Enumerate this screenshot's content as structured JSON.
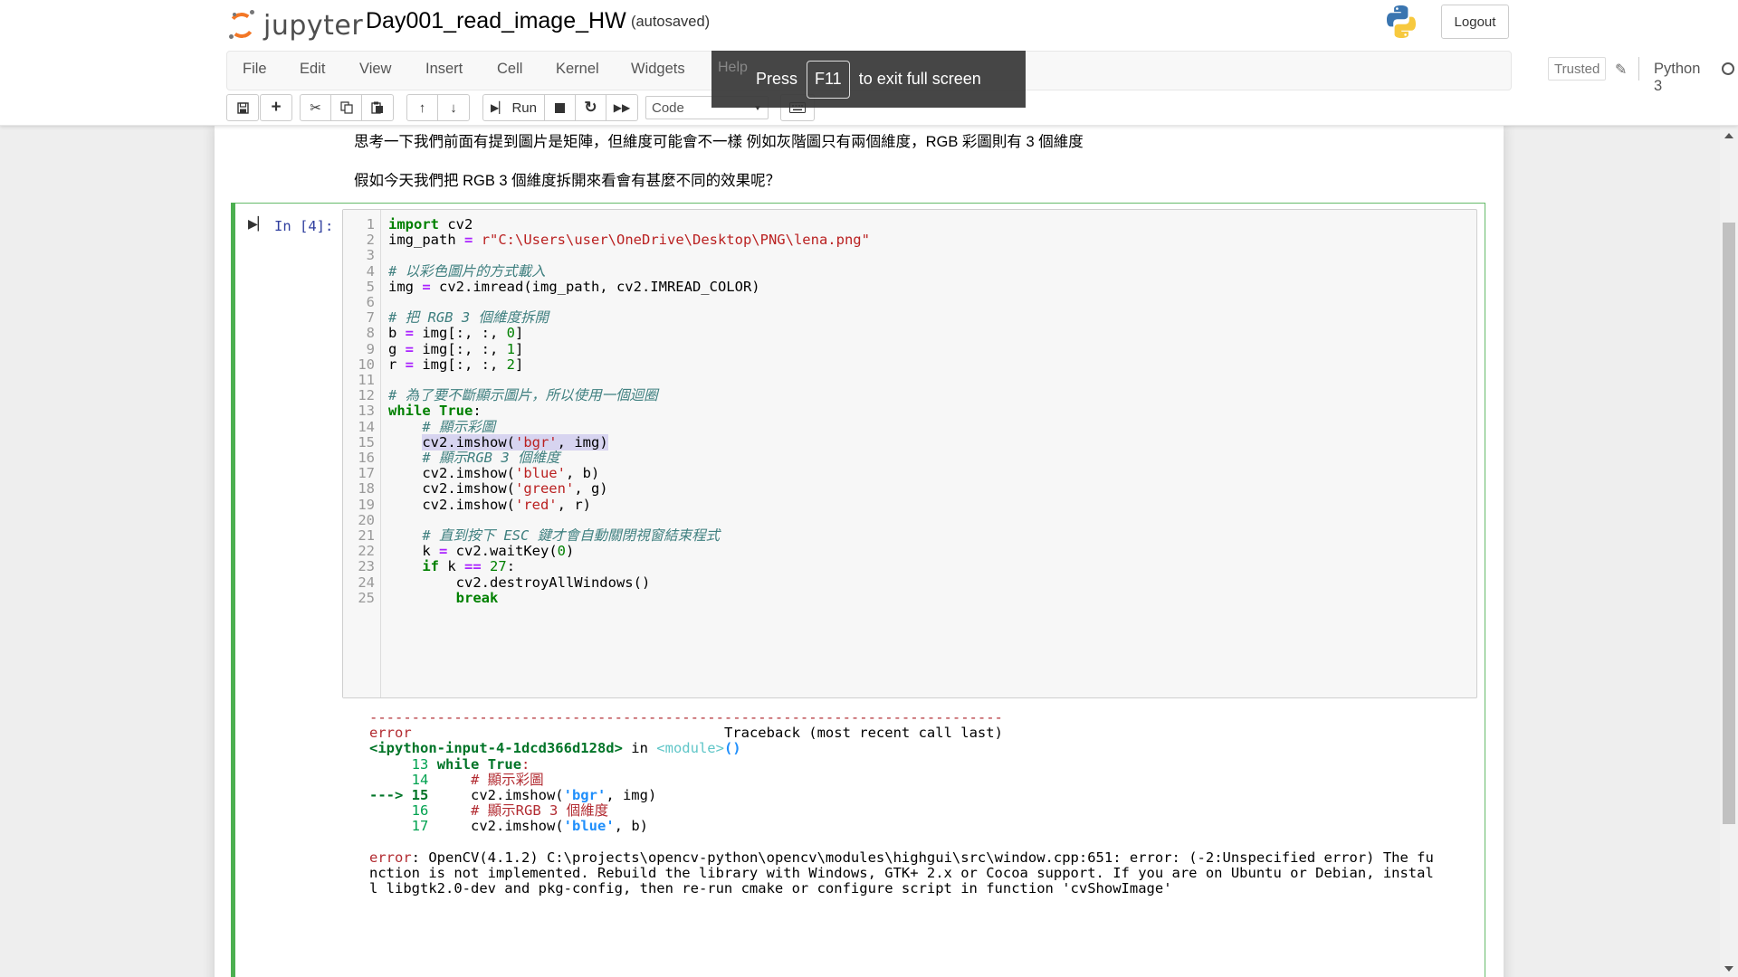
{
  "header": {
    "logo_text": "jupyter",
    "notebook_name": "Day001_read_image_HW",
    "save_status": "(autosaved)",
    "logout_label": "Logout"
  },
  "menubar": {
    "items": [
      "File",
      "Edit",
      "View",
      "Insert",
      "Cell",
      "Kernel",
      "Widgets",
      "Help"
    ],
    "trusted_label": "Trusted",
    "kernel_name": "Python 3"
  },
  "toolbar": {
    "run_label": "Run",
    "cell_type": "Code"
  },
  "fullscreen_toast": {
    "prefix": "Press",
    "key": "F11",
    "suffix": "to exit full screen"
  },
  "markdown": {
    "line1": "思考一下我們前面有提到圖片是矩陣，但維度可能會不一樣 例如灰階圖只有兩個維度，RGB 彩圖則有 3 個維度",
    "line2": "假如今天我們把 RGB 3 個維度拆開來看會有甚麼不同的效果呢？"
  },
  "cell": {
    "prompt": "In [4]:",
    "code_lines": [
      "import cv2",
      "img_path = r\"C:\\Users\\user\\OneDrive\\Desktop\\PNG\\lena.png\"",
      "",
      "# 以彩色圖片的方式載入",
      "img = cv2.imread(img_path, cv2.IMREAD_COLOR)",
      "",
      "# 把 RGB 3 個維度拆開",
      "b = img[:, :, 0]",
      "g = img[:, :, 1]",
      "r = img[:, :, 2]",
      "",
      "# 為了要不斷顯示圖片，所以使用一個迴圈",
      "while True:",
      "    # 顯示彩圖",
      "    cv2.imshow('bgr', img)",
      "    # 顯示RGB 3 個維度",
      "    cv2.imshow('blue', b)",
      "    cv2.imshow('green', g)",
      "    cv2.imshow('red', r)",
      "",
      "    # 直到按下 ESC 鍵才會自動關閉視窗結束程式",
      "    k = cv2.waitKey(0)",
      "    if k == 27:",
      "        cv2.destroyAllWindows()",
      "        break"
    ],
    "output_lines": [
      "---------------------------------------------------------------------------",
      "error                                     Traceback (most recent call last)",
      "<ipython-input-4-1dcd366d128d> in <module>()",
      "     13 while True:",
      "     14     # 顯示彩圖",
      "---> 15     cv2.imshow('bgr', img)",
      "     16     # 顯示RGB 3 個維度",
      "     17     cv2.imshow('blue', b)",
      "",
      "error: OpenCV(4.1.2) C:\\projects\\opencv-python\\opencv\\modules\\highgui\\src\\window.cpp:651: error: (-2:Unspecified error) The fu",
      "nction is not implemented. Rebuild the library with Windows, GTK+ 2.x or Cocoa support. If you are on Ubuntu or Debian, instal",
      "l libgtk2.0-dev and pkg-config, then re-run cmake or configure script in function 'cvShowImage'"
    ]
  }
}
